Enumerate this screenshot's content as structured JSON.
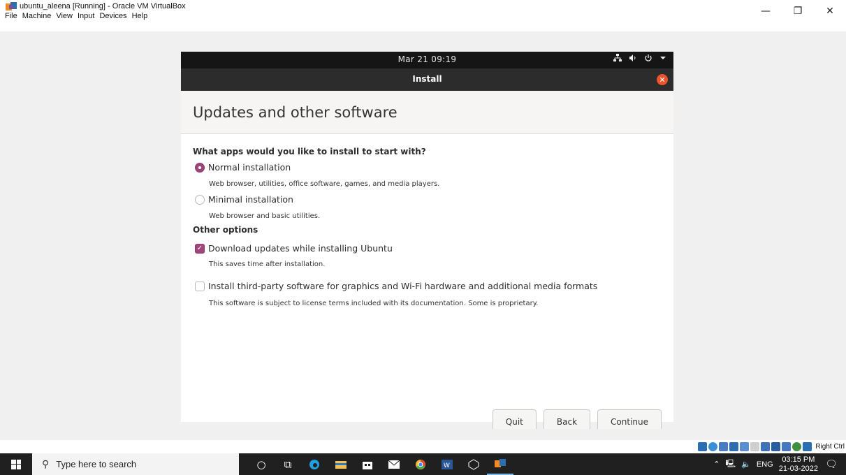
{
  "host": {
    "window_title": "ubuntu_aleena [Running] - Oracle VM VirtualBox",
    "menu": [
      "File",
      "Machine",
      "View",
      "Input",
      "Devices",
      "Help"
    ],
    "controls": {
      "minimize": "—",
      "restore": "❐",
      "close": "✕"
    }
  },
  "guest": {
    "topbar": {
      "clock": "Mar 21  09:19"
    },
    "installer": {
      "header_title": "Install",
      "page_title": "Updates and other software",
      "section1": "What apps would you like to install to start with?",
      "normal_label": "Normal installation",
      "normal_desc": "Web browser, utilities, office software, games, and media players.",
      "normal_selected": true,
      "minimal_label": "Minimal installation",
      "minimal_desc": "Web browser and basic utilities.",
      "section2": "Other options",
      "download_label": "Download updates while installing Ubuntu",
      "download_desc": "This saves time after installation.",
      "download_checked": true,
      "thirdparty_label": "Install third-party software for graphics and Wi-Fi hardware and additional media formats",
      "thirdparty_desc": "This software is subject to license terms included with its documentation. Some is proprietary.",
      "thirdparty_checked": false,
      "buttons": {
        "quit": "Quit",
        "back": "Back",
        "continue": "Continue"
      }
    },
    "accent_color": "#a0457a"
  },
  "vbox_status": {
    "host_key": "Right Ctrl"
  },
  "taskbar": {
    "search_placeholder": "Type here to search",
    "systray_lang": "ENG",
    "time": "03:15 PM",
    "date": "21-03-2022"
  }
}
